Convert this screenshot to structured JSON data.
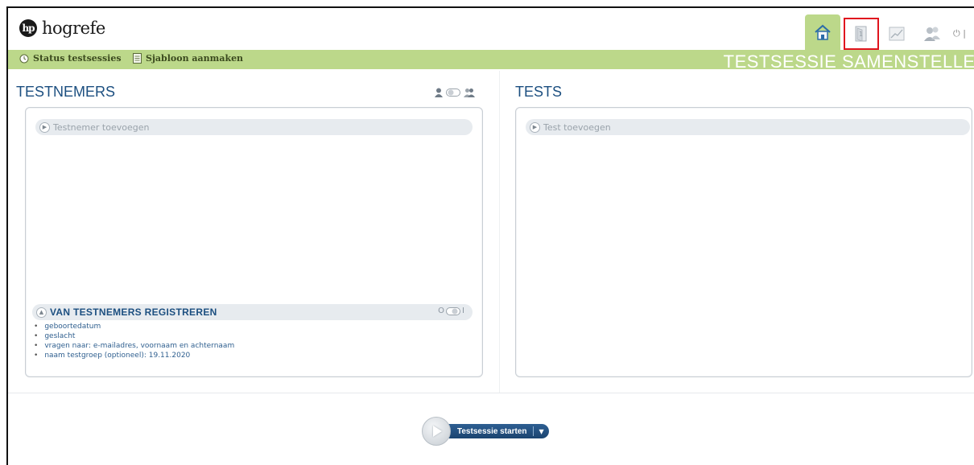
{
  "header": {
    "logo_mark": "hp",
    "logo_text": "hogrefe",
    "nav": [
      {
        "name": "home-icon",
        "active": true
      },
      {
        "name": "document-icon",
        "highlighted": true
      },
      {
        "name": "chart-icon"
      },
      {
        "name": "users-icon"
      }
    ],
    "power_symbol": "⏻ |"
  },
  "toolbar": {
    "status_label": "Status testsessies",
    "template_label": "Sjabloon aanmaken",
    "section_title": "TESTSESSIE SAMENSTELLEN"
  },
  "testnemers": {
    "title": "TESTNEMERS",
    "add_label": "Testnemer toevoegen",
    "register_title": "VAN TESTNEMERS REGISTREREN",
    "register_items": [
      "geboortedatum",
      "geslacht",
      "vragen naar: e-mailadres, voornaam en achternaam",
      "naam testgroep (optioneel): 19.11.2020"
    ],
    "toggle_left": "O",
    "toggle_right": "I"
  },
  "tests": {
    "title": "TESTS",
    "add_label": "Test toevoegen"
  },
  "start": {
    "label": "Testsessie starten",
    "caret": "▼"
  },
  "colors": {
    "accent_green": "#bcd88a",
    "title_blue": "#1c4f80",
    "highlight_red": "#e0141e"
  }
}
